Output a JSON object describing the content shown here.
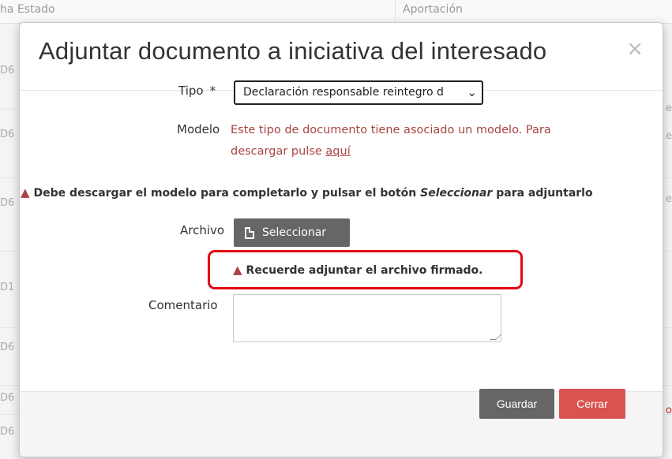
{
  "background": {
    "columns": [
      "ha Estado",
      "Aportación"
    ],
    "left_fragments": [
      "D6",
      "D6",
      "D6",
      "D1",
      "D6",
      "D6",
      "D6"
    ],
    "right_fragments": [
      "e",
      "e",
      "e",
      "o"
    ]
  },
  "modal": {
    "title": "Adjuntar documento a iniciativa del interesado",
    "close_symbol": "×",
    "tipo_label": "Tipo",
    "required_mark": "*",
    "tipo_selected": "Declaración responsable reintegro d",
    "modelo_label": "Modelo",
    "modelo_text": "Este tipo de documento tiene asociado un modelo. Para descargar pulse",
    "modelo_link": "aquí",
    "warning_prefix": "Debe descargar el modelo para completarlo y pulsar el botón",
    "warning_emphasis": "Seleccionar",
    "warning_suffix": "para adjuntarlo",
    "archivo_label": "Archivo",
    "select_button": "Seleccionar",
    "reminder": "Recuerde adjuntar el archivo firmado.",
    "comentario_label": "Comentario",
    "comentario_value": "",
    "guardar_button": "Guardar",
    "cerrar_button": "Cerrar"
  },
  "colors": {
    "error_red": "#a94442",
    "highlight_red": "#e30613",
    "cerrar_bg": "#d9534f",
    "button_gray": "#666666"
  },
  "icons": [
    "warning-triangle-icon",
    "file-icon",
    "close-icon",
    "chevron-down-icon"
  ]
}
